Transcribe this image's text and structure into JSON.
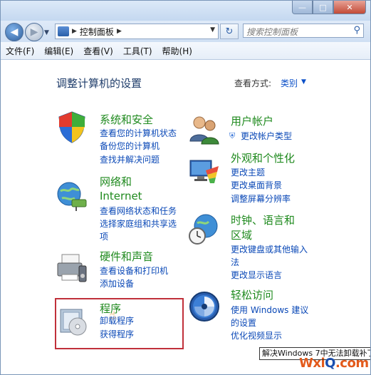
{
  "window": {
    "controls": {
      "minimize": "—",
      "maximize": "□",
      "close": "✕"
    }
  },
  "address_bar": {
    "crumb": "控制面板",
    "search_placeholder": "搜索控制面板"
  },
  "menu": [
    "文件(F)",
    "编辑(E)",
    "查看(V)",
    "工具(T)",
    "帮助(H)"
  ],
  "header": {
    "title": "调整计算机的设置",
    "view_by_label": "查看方式:",
    "view_by_value": "类别"
  },
  "categories": {
    "security": {
      "title": "系统和安全",
      "links": [
        "查看您的计算机状态",
        "备份您的计算机",
        "查找并解决问题"
      ]
    },
    "network": {
      "title_line1": "网络和",
      "title_line2": "Internet",
      "links": [
        "查看网络状态和任务",
        "选择家庭组和共享选",
        "项"
      ]
    },
    "hardware": {
      "title": "硬件和声音",
      "links": [
        "查看设备和打印机",
        "添加设备"
      ]
    },
    "programs": {
      "title": "程序",
      "links": [
        "卸载程序",
        "获得程序"
      ]
    },
    "users": {
      "title": "用户帐户",
      "links": [
        "更改帐户类型"
      ]
    },
    "appearance": {
      "title": "外观和个性化",
      "links": [
        "更改主题",
        "更改桌面背景",
        "调整屏幕分辨率"
      ]
    },
    "clock": {
      "title_line1": "时钟、语言和",
      "title_line2": "区域",
      "links": [
        "更改键盘或其他输入",
        "法",
        "更改显示语言"
      ]
    },
    "ease": {
      "title": "轻松访问",
      "links": [
        "使用 Windows 建议",
        "的设置",
        "优化视频显示"
      ]
    }
  },
  "tooltip": "解决Windows 7中无法卸载补丁",
  "watermark": {
    "part1": "Wxi",
    "part2": "Q",
    "part3": ".com"
  },
  "colors": {
    "accent": "#0b49b7",
    "category": "#1f8a1e",
    "highlight": "#c0303a"
  }
}
